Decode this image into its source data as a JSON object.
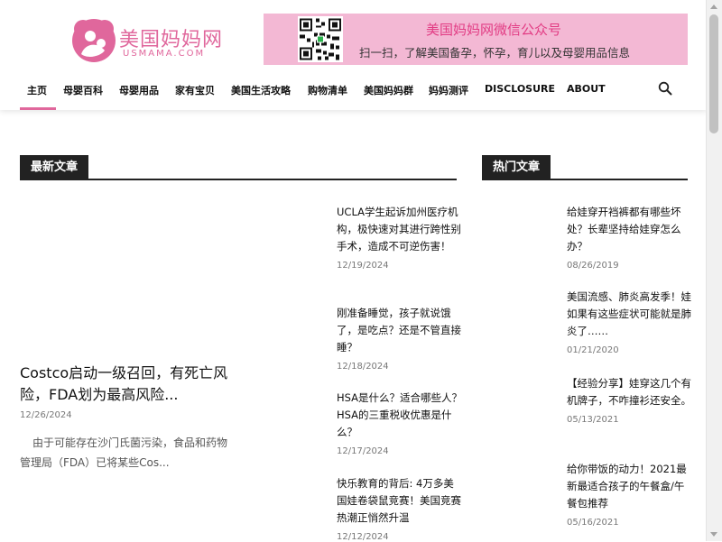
{
  "header": {
    "logo": {
      "text": "美国妈妈网",
      "sub": "USMAMA.COM"
    },
    "banner": {
      "title": "美国妈妈网微信公众号",
      "subtitle": "扫一扫，了解美国备孕，怀孕，育儿以及母婴用品信息"
    }
  },
  "nav": {
    "items": [
      {
        "label": "主页"
      },
      {
        "label": "母婴百科"
      },
      {
        "label": "母婴用品"
      },
      {
        "label": "家有宝贝"
      },
      {
        "label": "美国生活攻略"
      },
      {
        "label": "购物清单"
      },
      {
        "label": "美国妈妈群"
      },
      {
        "label": "妈妈测评"
      },
      {
        "label": "DISCLOSURE"
      },
      {
        "label": "ABOUT"
      }
    ],
    "search_icon": "search-icon"
  },
  "latest": {
    "title": "最新文章",
    "feature": {
      "title": "Costco启动一级召回，有死亡风险，FDA划为最高风险...",
      "date": "12/26/2024",
      "excerpt": "由于可能存在沙门氏菌污染，食品和药物管理局（FDA）已将某些Cos..."
    },
    "items": [
      {
        "title": "UCLA学生起诉加州医疗机构，极快速对其进行跨性别手术，造成不可逆伤害！",
        "date": "12/19/2024"
      },
      {
        "title": "刚准备睡觉，孩子就说饿了，是吃点？还是不管直接睡？",
        "date": "12/18/2024"
      },
      {
        "title": "HSA是什么？适合哪些人？HSA的三重税收优惠是什么？",
        "date": "12/17/2024"
      },
      {
        "title": "快乐教育的背后: 4万多美国娃卷袋鼠竞赛！美国竞赛热潮正悄然升温",
        "date": "12/12/2024"
      }
    ]
  },
  "popular": {
    "title": "热门文章",
    "items": [
      {
        "title": "给娃穿开裆裤都有哪些坏处？长辈坚持给娃穿怎么办？",
        "date": "08/26/2019"
      },
      {
        "title": "美国流感、肺炎高发季！娃如果有这些症状可能就是肺炎了……",
        "date": "01/21/2020"
      },
      {
        "title": "【经验分享】娃穿这几个有机牌子，不咋撞衫还安全。",
        "date": "05/13/2021"
      },
      {
        "title": "给你带饭的动力！2021最新最适合孩子的午餐盒/午餐包推荐",
        "date": "05/16/2021"
      }
    ]
  },
  "colors": {
    "brand_pink": "#e0679c",
    "banner_bg": "#f3b8d4",
    "block_title_bg": "#222222"
  }
}
